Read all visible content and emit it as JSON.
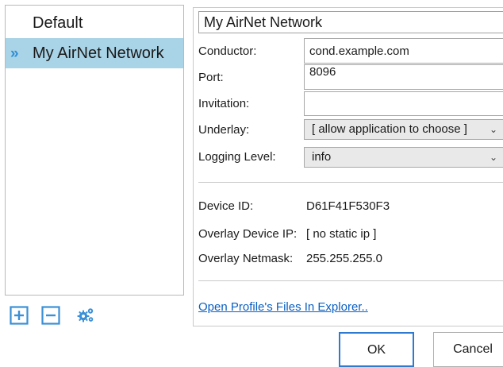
{
  "profiles": {
    "items": [
      {
        "label": "Default"
      },
      {
        "label": "My AirNet Network",
        "marker": "»"
      }
    ]
  },
  "list_tools": {
    "add_icon": "plus-box-icon",
    "remove_icon": "minus-box-icon",
    "settings_icon": "gears-icon"
  },
  "detail": {
    "profile_name": "My AirNet Network",
    "conductor": {
      "label": "Conductor:",
      "value": "cond.example.com"
    },
    "port": {
      "label": "Port:",
      "value": "8096"
    },
    "invitation": {
      "label": "Invitation:",
      "value": ""
    },
    "underlay": {
      "label": "Underlay:",
      "selected": "[ allow application to choose ]"
    },
    "logging_level": {
      "label": "Logging Level:",
      "selected": "info"
    },
    "device_id": {
      "label": "Device ID:",
      "value": "D61F41F530F3"
    },
    "overlay_ip": {
      "label": "Overlay Device IP:",
      "value": "[ no static ip ]"
    },
    "overlay_netmask": {
      "label": "Overlay Netmask:",
      "value": "255.255.255.0"
    },
    "open_files_link": "Open Profile's Files In Explorer.."
  },
  "buttons": {
    "ok": "OK",
    "cancel": "Cancel"
  },
  "colors": {
    "selection": "#a9d3e6",
    "accent": "#2f8fd3",
    "link": "#0a5fc2"
  }
}
